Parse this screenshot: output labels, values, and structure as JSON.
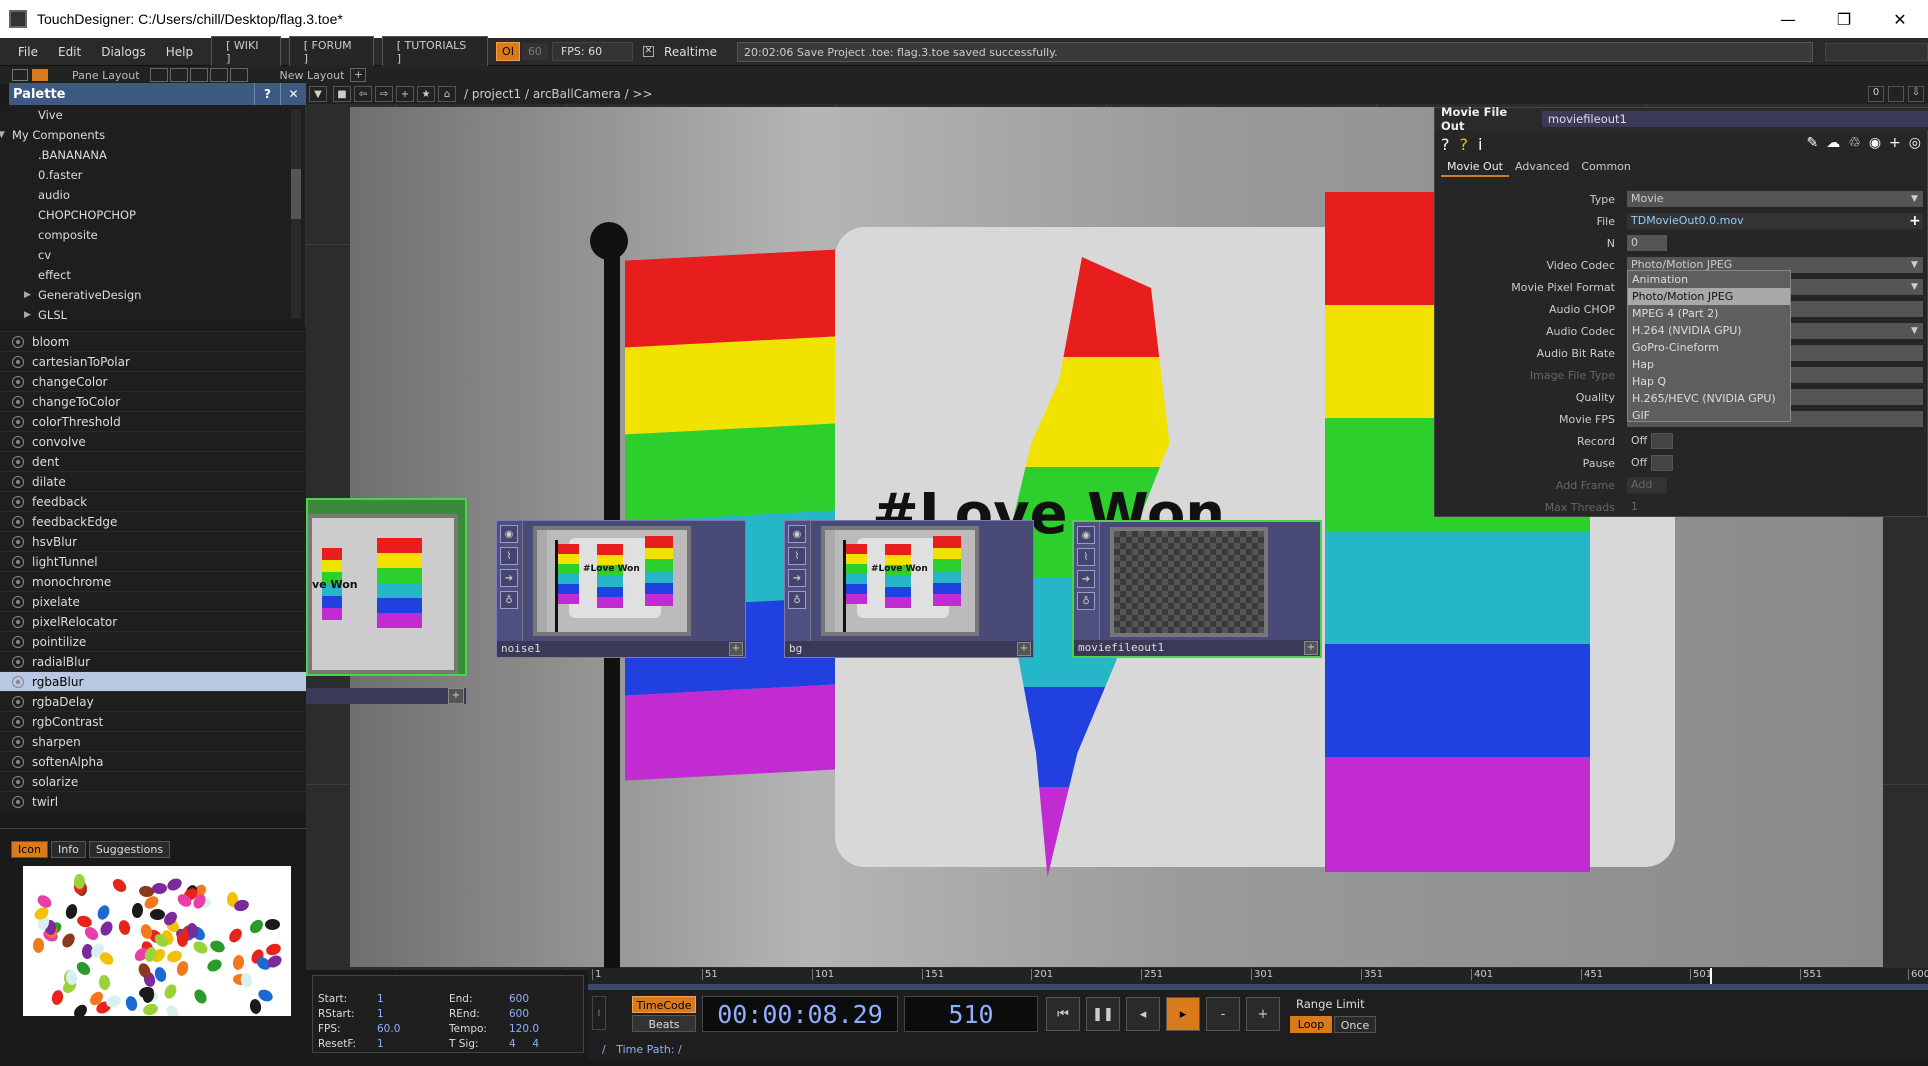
{
  "window": {
    "title": "TouchDesigner: C:/Users/chill/Desktop/flag.3.toe*",
    "minimize": "—",
    "restore": "❐",
    "close": "✕"
  },
  "menu": [
    "File",
    "Edit",
    "Dialogs",
    "Help"
  ],
  "links": [
    "[ WIKI ]",
    "[ FORUM ]",
    "[ TUTORIALS ]"
  ],
  "oi_label": "OI",
  "fps_limit": "60",
  "fps_label": "FPS:",
  "fps_value": "60",
  "realtime_label": "Realtime",
  "status_message": "20:02:06 Save Project .toe: flag.3.toe saved successfully.",
  "toolbar": {
    "pane_layout": "Pane Layout",
    "new_layout": "New Layout"
  },
  "palette": {
    "title": "Palette",
    "help": "?",
    "close": "✕",
    "tree": [
      {
        "label": "Vive",
        "indent": 2
      },
      {
        "label": "My Components",
        "indent": 1,
        "expanded": true
      },
      {
        "label": ".BANANANA",
        "indent": 2
      },
      {
        "label": "0.faster",
        "indent": 2
      },
      {
        "label": "audio",
        "indent": 2
      },
      {
        "label": "CHOPCHOPCHOP",
        "indent": 2
      },
      {
        "label": "composite",
        "indent": 2
      },
      {
        "label": "cv",
        "indent": 2
      },
      {
        "label": "effect",
        "indent": 2
      },
      {
        "label": "GenerativeDesign",
        "indent": 2,
        "collapsed": true
      },
      {
        "label": "GLSL",
        "indent": 2,
        "collapsed": true
      }
    ],
    "items": [
      "bloom",
      "cartesianToPolar",
      "changeColor",
      "changeToColor",
      "colorThreshold",
      "convolve",
      "dent",
      "dilate",
      "feedback",
      "feedbackEdge",
      "hsvBlur",
      "lightTunnel",
      "monochrome",
      "pixelate",
      "pixelRelocator",
      "pointilize",
      "radialBlur",
      "rgbaBlur",
      "rgbaDelay",
      "rgbContrast",
      "sharpen",
      "softenAlpha",
      "solarize",
      "twirl"
    ],
    "selected": "rgbaBlur",
    "tabs": [
      "Icon",
      "Info",
      "Suggestions"
    ],
    "active_tab": "Icon"
  },
  "network": {
    "path": "/ project1 / arcBallCamera / >>",
    "flag_text": "#Love Won",
    "nodes": [
      {
        "name": "",
        "flag_text": "ve Won"
      },
      {
        "name": "noise1",
        "flag_text": "#Love Won"
      },
      {
        "name": "bg",
        "flag_text": "#Love Won"
      },
      {
        "name": "moviefileout1",
        "flag_text": ""
      }
    ]
  },
  "params": {
    "op_type": "Movie File Out",
    "op_name": "moviefileout1",
    "tabs": [
      "Movie Out",
      "Advanced",
      "Common"
    ],
    "active_tab": "Movie Out",
    "rows": [
      {
        "label": "Type",
        "value": "Movie"
      },
      {
        "label": "File",
        "value": "TDMovieOut0.0.mov"
      },
      {
        "label": "N",
        "value": "0"
      },
      {
        "label": "Video Codec",
        "value": "Photo/Motion JPEG"
      },
      {
        "label": "Movie Pixel Format",
        "value": ""
      },
      {
        "label": "Audio CHOP",
        "value": ""
      },
      {
        "label": "Audio Codec",
        "value": ""
      },
      {
        "label": "Audio Bit Rate",
        "value": ""
      },
      {
        "label": "Image File Type",
        "value": ""
      },
      {
        "label": "Quality",
        "value": ""
      },
      {
        "label": "Movie FPS",
        "value": ""
      },
      {
        "label": "Record",
        "value": "Off"
      },
      {
        "label": "Pause",
        "value": "Off"
      },
      {
        "label": "Add Frame",
        "value": "Add"
      },
      {
        "label": "Max Threads",
        "value": "1"
      }
    ],
    "codec_options": [
      "Animation",
      "Photo/Motion JPEG",
      "MPEG 4 (Part 2)",
      "H.264 (NVIDIA GPU)",
      "GoPro-Cineform",
      "Hap",
      "Hap Q",
      "H.265/HEVC (NVIDIA GPU)",
      "GIF"
    ],
    "codec_selected": "Photo/Motion JPEG"
  },
  "timeline": {
    "ticks": [
      "1",
      "51",
      "101",
      "151",
      "201",
      "251",
      "301",
      "351",
      "401",
      "451",
      "501",
      "551",
      "600"
    ],
    "start_label": "Start:",
    "start": "1",
    "end_label": "End:",
    "end": "600",
    "rstart_label": "RStart:",
    "rstart": "1",
    "rend_label": "REnd:",
    "rend": "600",
    "fps_label": "FPS:",
    "fps": "60.0",
    "tempo_label": "Tempo:",
    "tempo": "120.0",
    "resetf_label": "ResetF:",
    "resetf": "1",
    "tsig_label": "T Sig:",
    "tsig_a": "4",
    "tsig_b": "4",
    "timecode_btn": "TimeCode",
    "beats_btn": "Beats",
    "timecode": "00:00:08.29",
    "frame": "510",
    "range_limit": "Range Limit",
    "loop": "Loop",
    "once": "Once",
    "time_path": "Time Path: /",
    "slash": "/"
  }
}
